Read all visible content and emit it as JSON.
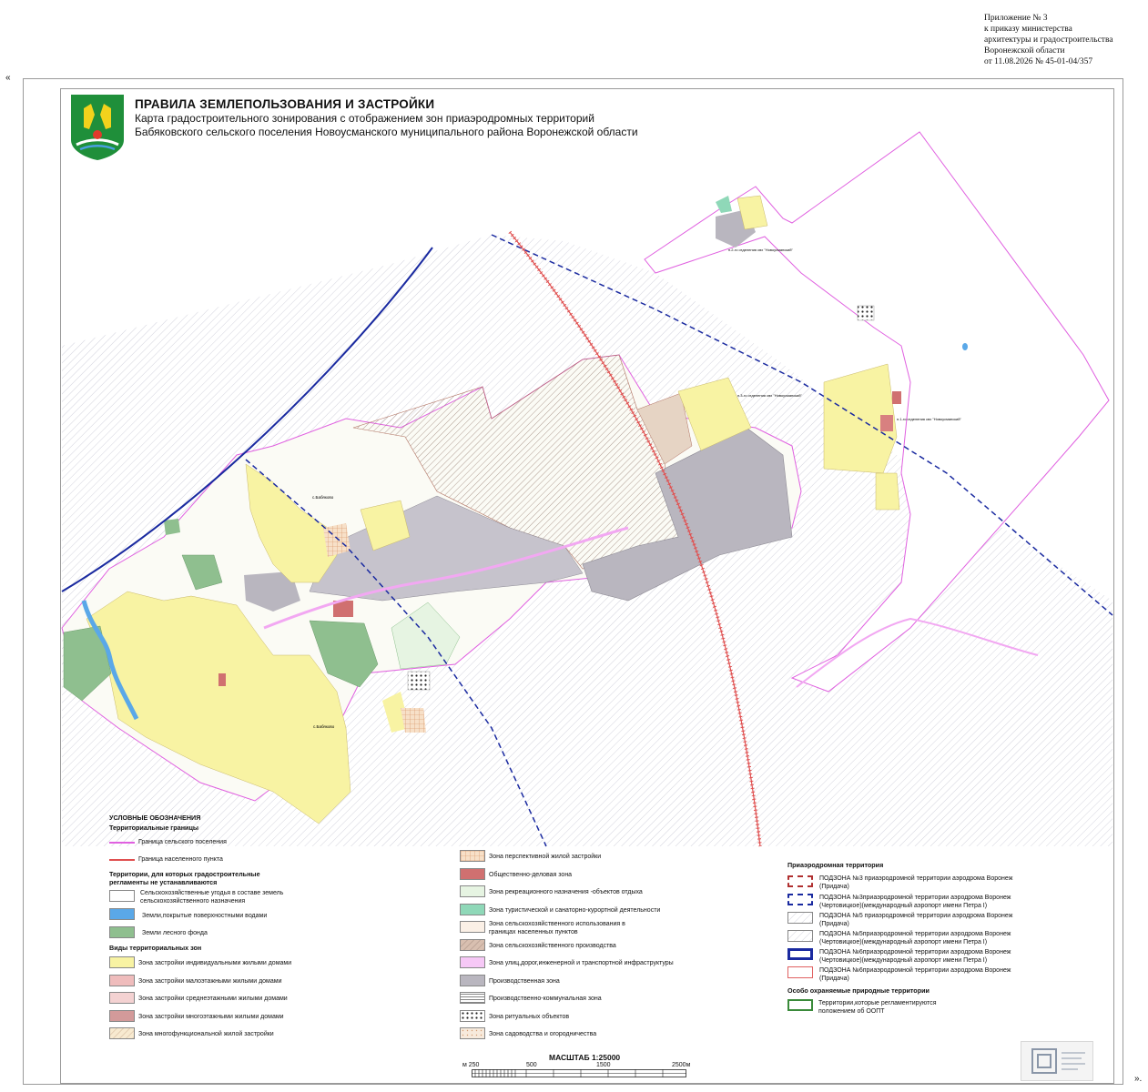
{
  "header": {
    "appendix_lines": "Приложение № 3\nк приказу министерства\nархитектуры и градостроительства\nВоронежской области\nот 11.08.2026 № 45-01-04/357",
    "quote_open": "«",
    "quote_close": "»."
  },
  "title": {
    "main": "ПРАВИЛА ЗЕМЛЕПОЛЬЗОВАНИЯ И ЗАСТРОЙКИ",
    "line1": "Карта градостроительного зонирования с отображением зон приаэродромных территорий",
    "line2": "Бабяковского сельского поселения Новоусманского муниципального района Воронежской области"
  },
  "map_labels": {
    "babyakovo_n": "с.Бабяково",
    "babyakovo_s": "с.Бабяково",
    "otd2": "п.2-го отделения свх \"Новоусманский\"",
    "otd3": "п.3-го отделения свх \"Новоусманский\"",
    "otd1": "п.1-го отделения свх \"Новоусманский\""
  },
  "legend": {
    "title": "УСЛОВНЫЕ ОБОЗНАЧЕНИЯ",
    "sec_borders": "Территориальные границы",
    "border_settlement": "Граница сельского поселения",
    "border_locality": "Граница населенного пункта",
    "sec_no_regs": "Территории, для которых градостроительные регламенты не устанавливаются",
    "agri_land": "Сельскохозяйственные угодья в составе земель сельскохозяйственного назначения",
    "water": "Земли,покрытые поверхностными водами",
    "forest": "Земли лесного фонда",
    "sec_zones": "Виды территориальных зон",
    "z_individual": "Зона застройки индивидуальными жилыми домами",
    "z_lowrise": "Зона застройки малоэтажными жилыми домами",
    "z_midrise": "Зона застройки среднеэтажными жилыми домами",
    "z_highrise": "Зона застройки многоэтажными жилыми домами",
    "z_multifunc": "Зона многофункциональной жилой застройки",
    "z_perspective": "Зона перспективной жилой застройки",
    "z_business": "Общественно-деловая зона",
    "z_recreation": "Зона рекреационного назначения -объектов отдыха",
    "z_tourism": "Зона туристической и санаторно-курортной деятельности",
    "z_agri_use": "Зона сельскохозяйственного использования в границах населенных пунктов",
    "z_agri_prod": "Зона сельскохозяйственного производства",
    "z_streets": "Зона улиц,дорог,инженерной и транспортной инфраструктуры",
    "z_industrial": "Производственная зона",
    "z_ind_comm": "Производственно-коммунальная зона",
    "z_ritual": "Зона ритуальных объектов",
    "z_garden": "Зона садоводства и огородничества",
    "sec_airfield": "Приаэродромная территория",
    "a3": "ПОДЗОНА №3 приаэродромной территории аэродрома Воронеж (Придача)",
    "a3b": "ПОДЗОНА №3приаэродромной территории аэродрома Воронеж (Чертовицкое)(международный аэропорт имени Петра I)",
    "a5": "ПОДЗОНА №5 приаэродромной территории аэродрома Воронеж (Придача)",
    "a5b": "ПОДЗОНА №5приаэродромной территории аэродрома Воронеж (Чертовицкое)(международный аэропорт имени Петра I)",
    "a6b": "ПОДЗОНА №6приаэродромной территории аэродрома Воронеж (Чертовицкое)(международный аэропорт имени Петра I)",
    "a6": "ПОДЗОНА №6приаэродромной территории аэродрома Воронеж (Придача)",
    "sec_protected": "Особо охраняемые природные территории",
    "protected": "Территории,которые регламентируются положением об ООПТ"
  },
  "scale": {
    "title": "МАСШТАБ 1:25000",
    "l0": "м 250",
    "l1": "500",
    "l2": "1500",
    "l3": "2500м"
  },
  "colors": {
    "yellow": "#f8f3a3",
    "pink_border": "#e060e0",
    "red_border": "#e05050",
    "blue_dash": "#1a2aa0",
    "agri_prod": "#d8bfb0",
    "industrial": "#b9b6bf",
    "forest": "#8fbf8f",
    "water": "#5aa8e8"
  }
}
